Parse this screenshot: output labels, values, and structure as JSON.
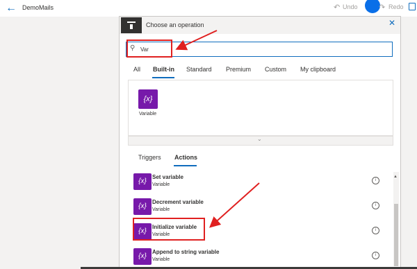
{
  "app": {
    "title": "DemoMails",
    "undo_label": "Undo",
    "redo_label": "Redo"
  },
  "dialog": {
    "title": "Choose an operation",
    "search": {
      "value": "Var",
      "placeholder": ""
    },
    "tabs": [
      "All",
      "Built-in",
      "Standard",
      "Premium",
      "Custom",
      "My clipboard"
    ],
    "active_tab": "Built-in",
    "connector": {
      "label": "Variable",
      "icon_text": "{x}"
    },
    "subtabs": [
      "Triggers",
      "Actions"
    ],
    "active_subtab": "Actions",
    "actions": [
      {
        "name": "Set variable",
        "sub": "Variable",
        "icon_text": "{x}"
      },
      {
        "name": "Decrement variable",
        "sub": "Variable",
        "icon_text": "{x}"
      },
      {
        "name": "Initialize variable",
        "sub": "Variable",
        "icon_text": "{x}"
      },
      {
        "name": "Append to string variable",
        "sub": "Variable",
        "icon_text": "{x}"
      }
    ]
  },
  "icons": {
    "back": "arrow-left-icon",
    "undo": "undo-icon",
    "redo": "redo-icon",
    "save": "save-icon",
    "operation": "operation-icon",
    "close": "close-icon",
    "search": "search-icon",
    "info": "info-icon",
    "expand": "chevron-down-icon"
  },
  "colors": {
    "accent": "#0f6cbd",
    "variable_tile": "#7719aa",
    "annotation": "#e02020"
  }
}
